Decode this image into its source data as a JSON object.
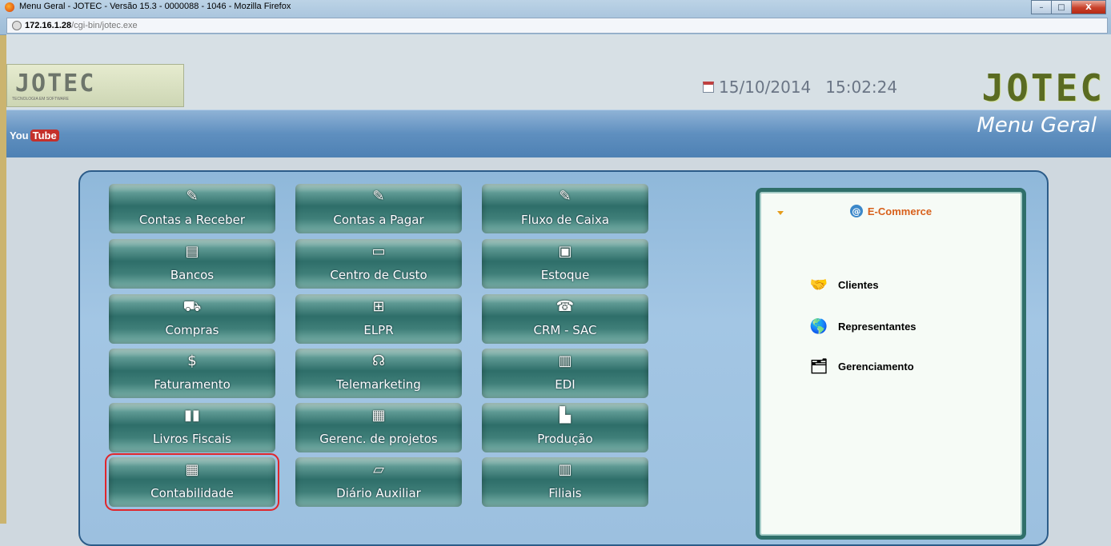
{
  "window": {
    "title": "Menu Geral - JOTEC - Versão 15.3 - 0000088 - 1046 - Mozilla Firefox",
    "url_host": "172.16.1.28",
    "url_path": "/cgi-bin/jotec.exe",
    "controls": [
      "–",
      "□",
      "X"
    ]
  },
  "header": {
    "logo_text": "JOTEC",
    "logo_subtitle": "TECNOLOGIA EM SOFTWARE",
    "date": "15/10/2014",
    "time": "15:02:24",
    "brand": "JOTEC"
  },
  "band": {
    "youtube_you": "You",
    "youtube_tube": "Tube",
    "page_title": "Menu Geral"
  },
  "modules": [
    {
      "label": "Contas a Receber",
      "icon": "printer-tray-icon"
    },
    {
      "label": "Contas a Pagar",
      "icon": "printer-tray-icon"
    },
    {
      "label": "Fluxo de Caixa",
      "icon": "printer-tray-icon"
    },
    {
      "label": "Bancos",
      "icon": "bank-icon"
    },
    {
      "label": "Centro de Custo",
      "icon": "folder-icon"
    },
    {
      "label": "Estoque",
      "icon": "box-icon"
    },
    {
      "label": "Compras",
      "icon": "cart-icon"
    },
    {
      "label": "ELPR",
      "icon": "network-icon"
    },
    {
      "label": "CRM - SAC",
      "icon": "phone-icon"
    },
    {
      "label": "Faturamento",
      "icon": "invoice-icon"
    },
    {
      "label": "Telemarketing",
      "icon": "headset-icon"
    },
    {
      "label": "EDI",
      "icon": "document-icon"
    },
    {
      "label": "Livros Fiscais",
      "icon": "books-icon"
    },
    {
      "label": "Gerenc. de projetos",
      "icon": "projects-icon"
    },
    {
      "label": "Produção",
      "icon": "factory-icon"
    },
    {
      "label": "Contabilidade",
      "icon": "calculator-icon"
    },
    {
      "label": "Diário Auxiliar",
      "icon": "journal-icon"
    },
    {
      "label": "Filiais",
      "icon": "buildings-icon"
    }
  ],
  "ecommerce": {
    "title": "E-Commerce",
    "items": [
      {
        "label": "Clientes",
        "icon": "handshake-icon"
      },
      {
        "label": "Representantes",
        "icon": "globe-icon"
      },
      {
        "label": "Gerenciamento",
        "icon": "stacked-docs-icon"
      }
    ]
  },
  "selected_module": "Contabilidade"
}
